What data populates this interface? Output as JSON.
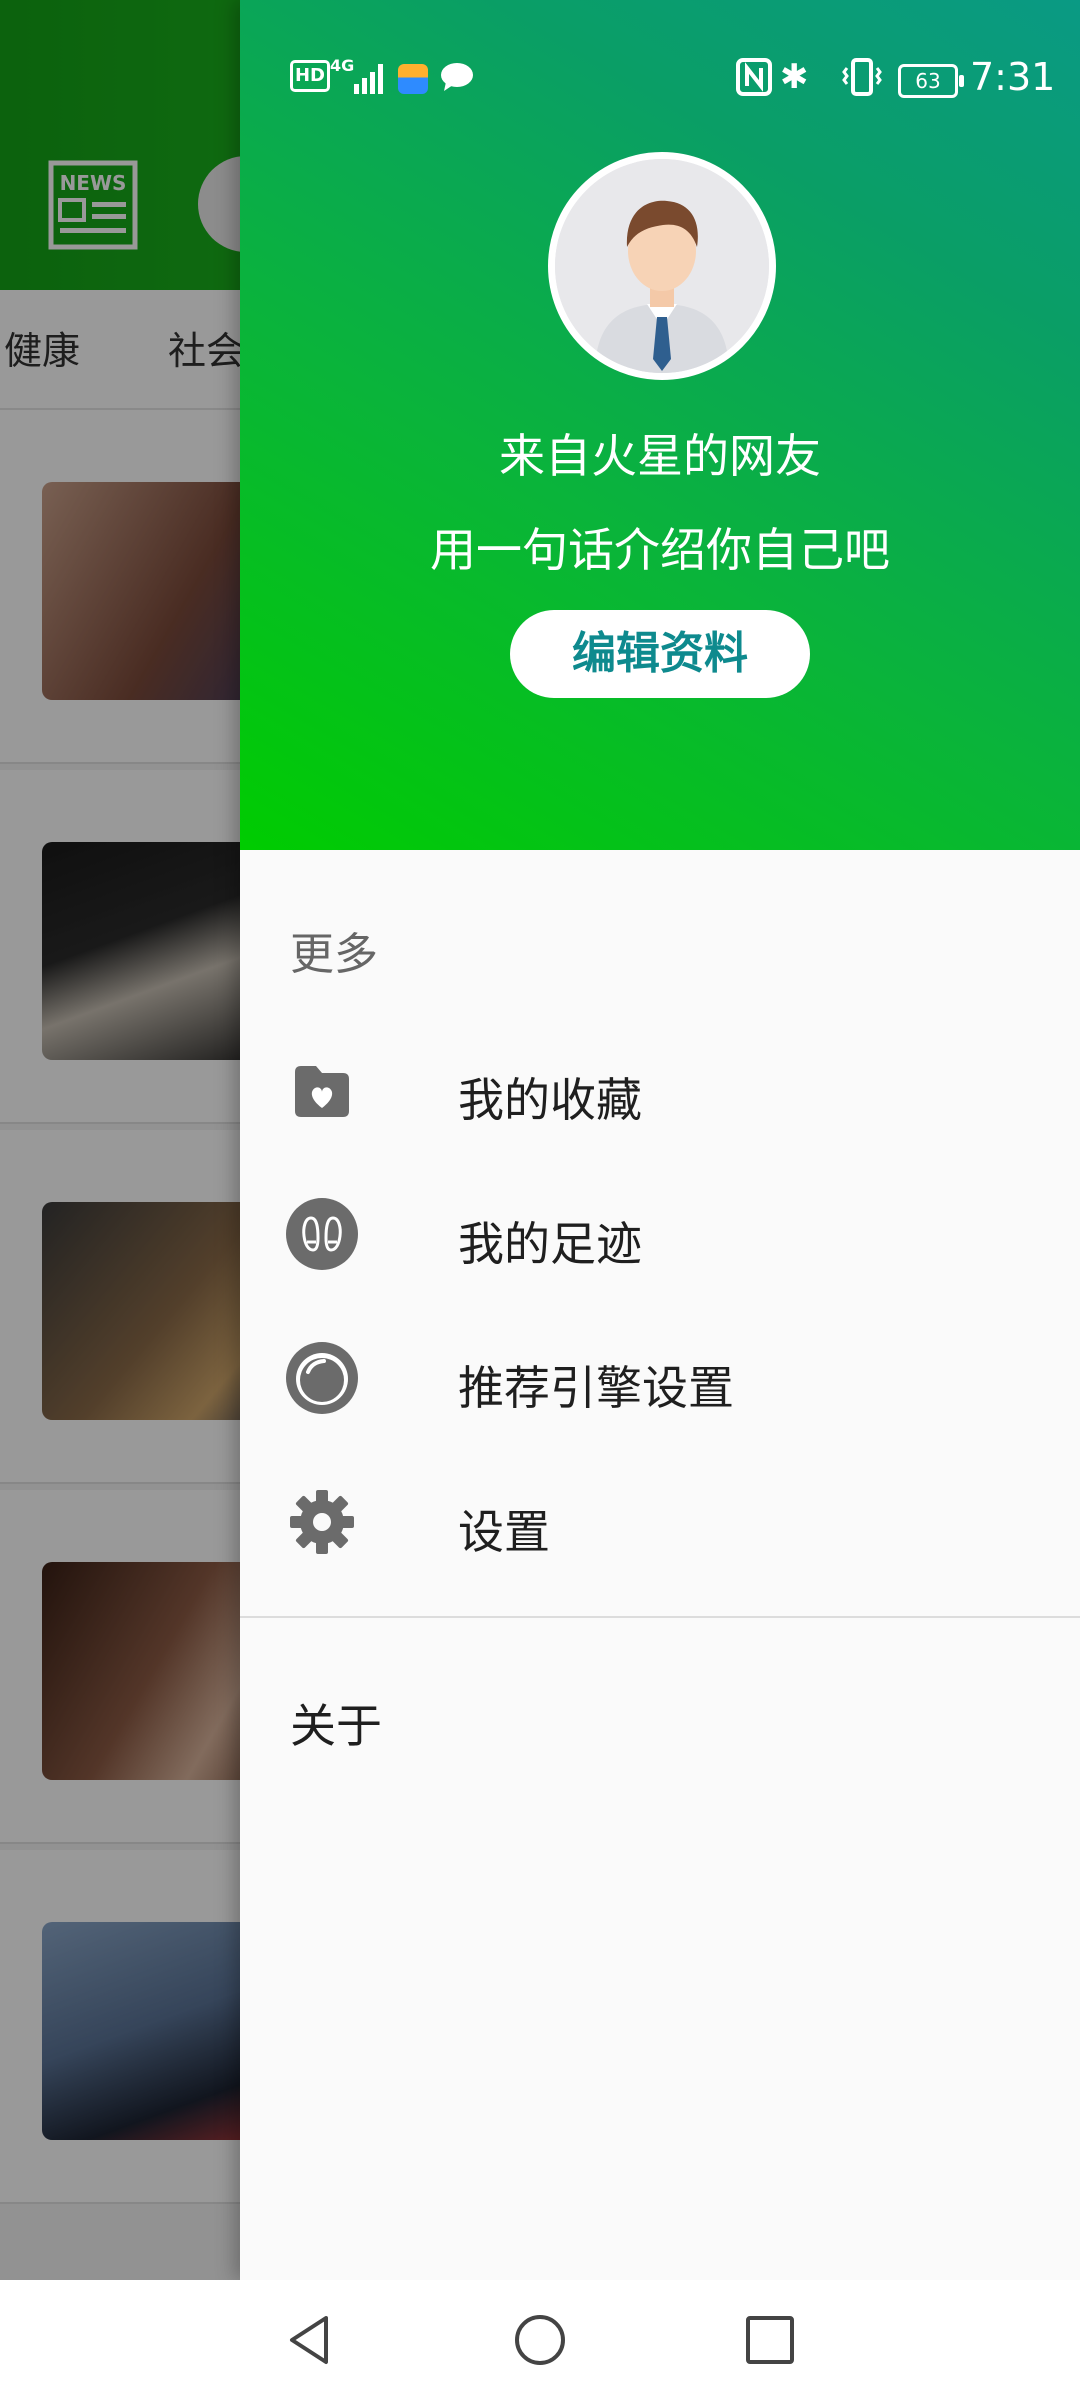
{
  "status_bar": {
    "hd": "HD",
    "network": "4G",
    "time": "7:31",
    "battery": "63",
    "icons": [
      "hd-icon",
      "signal-icon",
      "wallet-icon",
      "chat-icon",
      "nfc-icon",
      "bluetooth-icon",
      "vibrate-icon",
      "battery-icon"
    ]
  },
  "background_app": {
    "logo_text": "NEWS",
    "tabs": [
      "健康",
      "社会"
    ]
  },
  "drawer": {
    "profile": {
      "nickname": "来自火星的网友",
      "bio": "用一句话介绍你自己吧",
      "edit_button": "编辑资料"
    },
    "section_title": "更多",
    "menu_items": [
      {
        "label": "我的收藏",
        "icon": "favorites-folder-icon"
      },
      {
        "label": "我的足迹",
        "icon": "footprints-icon"
      },
      {
        "label": "推荐引擎设置",
        "icon": "recommendation-engine-icon"
      },
      {
        "label": "设置",
        "icon": "gear-icon"
      }
    ],
    "about": "关于"
  },
  "nav_bar": {
    "buttons": [
      "back-icon",
      "home-icon",
      "recents-icon"
    ]
  },
  "colors": {
    "header_gradient_start": "#00cc00",
    "header_gradient_end": "#0a9a84",
    "edit_button_text": "#0e8a8e",
    "icon_gray": "#6b6b6b"
  }
}
